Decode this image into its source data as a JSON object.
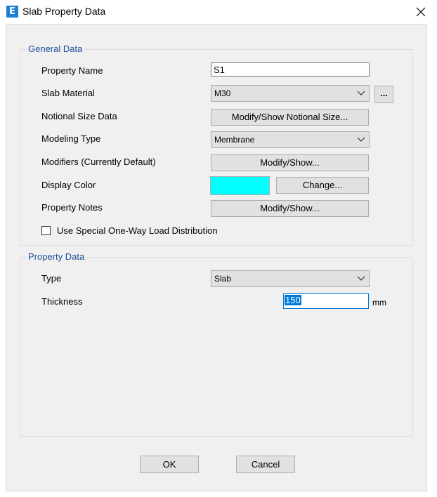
{
  "window": {
    "title": "Slab Property Data",
    "icon_letter": "E"
  },
  "general": {
    "legend": "General Data",
    "property_name_label": "Property Name",
    "property_name_value": "S1",
    "slab_material_label": "Slab Material",
    "slab_material_value": "M30",
    "material_more_label": "...",
    "notional_label": "Notional Size Data",
    "notional_button": "Modify/Show Notional Size...",
    "modeling_label": "Modeling Type",
    "modeling_value": "Membrane",
    "modifiers_label": "Modifiers (Currently Default)",
    "modifiers_button": "Modify/Show...",
    "display_color_label": "Display Color",
    "display_color_value": "#00ffff",
    "change_button": "Change...",
    "notes_label": "Property Notes",
    "notes_button": "Modify/Show...",
    "one_way_label": "Use Special One-Way Load Distribution",
    "one_way_checked": false
  },
  "property": {
    "legend": "Property Data",
    "type_label": "Type",
    "type_value": "Slab",
    "thickness_label": "Thickness",
    "thickness_value": "150",
    "thickness_unit": "mm"
  },
  "footer": {
    "ok": "OK",
    "cancel": "Cancel"
  }
}
